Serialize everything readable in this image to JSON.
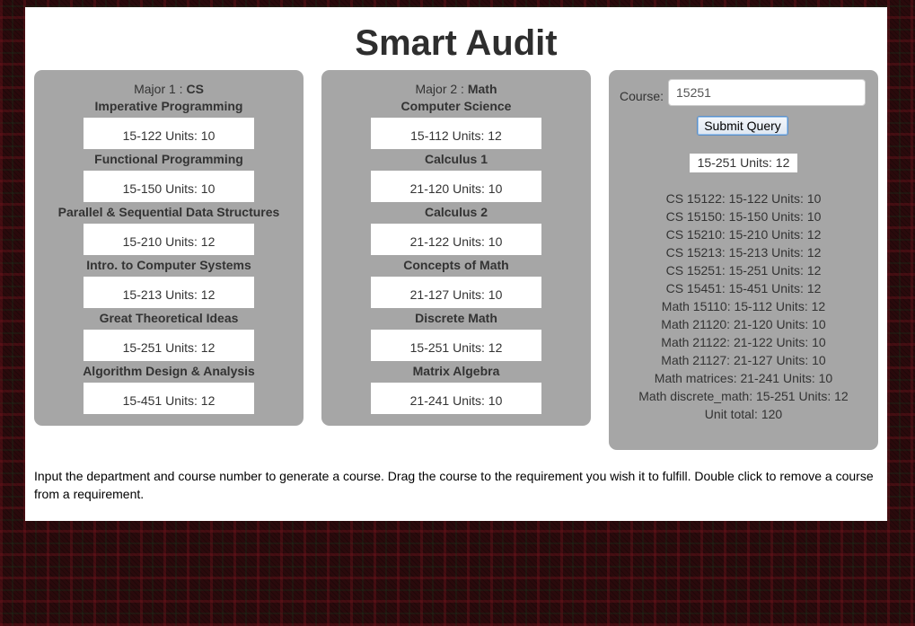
{
  "title": "Smart Audit",
  "majors": [
    {
      "label": "Major 1 : ",
      "name": "CS",
      "requirements": [
        {
          "title": "Imperative Programming",
          "course": "15-122 Units: 10"
        },
        {
          "title": "Functional Programming",
          "course": "15-150 Units: 10"
        },
        {
          "title": "Parallel & Sequential Data Structures",
          "course": "15-210 Units: 12"
        },
        {
          "title": "Intro. to Computer Systems",
          "course": "15-213 Units: 12"
        },
        {
          "title": "Great Theoretical Ideas",
          "course": "15-251 Units: 12"
        },
        {
          "title": "Algorithm Design & Analysis",
          "course": "15-451 Units: 12"
        }
      ]
    },
    {
      "label": "Major 2 : ",
      "name": "Math",
      "requirements": [
        {
          "title": "Computer Science",
          "course": "15-112 Units: 12"
        },
        {
          "title": "Calculus 1",
          "course": "21-120 Units: 10"
        },
        {
          "title": "Calculus 2",
          "course": "21-122 Units: 10"
        },
        {
          "title": "Concepts of Math",
          "course": "21-127 Units: 10"
        },
        {
          "title": "Discrete Math",
          "course": "15-251 Units: 12"
        },
        {
          "title": "Matrix Algebra",
          "course": "21-241 Units: 10"
        }
      ]
    }
  ],
  "course_form": {
    "label": "Course:",
    "value": "15251",
    "submit_label": "Submit Query",
    "generated_course": "15-251 Units: 12"
  },
  "summary": [
    "CS 15122: 15-122 Units: 10",
    "CS 15150: 15-150 Units: 10",
    "CS 15210: 15-210 Units: 12",
    "CS 15213: 15-213 Units: 12",
    "CS 15251: 15-251 Units: 12",
    "CS 15451: 15-451 Units: 12",
    "Math 15110: 15-112 Units: 12",
    "Math 21120: 21-120 Units: 10",
    "Math 21122: 21-122 Units: 10",
    "Math 21127: 21-127 Units: 10",
    "Math matrices: 21-241 Units: 10",
    "Math discrete_math: 15-251 Units: 12",
    "Unit total: 120"
  ],
  "instructions": "Input the department and course number to generate a course. Drag the course to the requirement you wish it to fulfill. Double click to remove a course from a requirement.",
  "colors": {
    "panel": "#a6a6a6",
    "slot": "#ffffff",
    "background": "#2a0a0c"
  }
}
